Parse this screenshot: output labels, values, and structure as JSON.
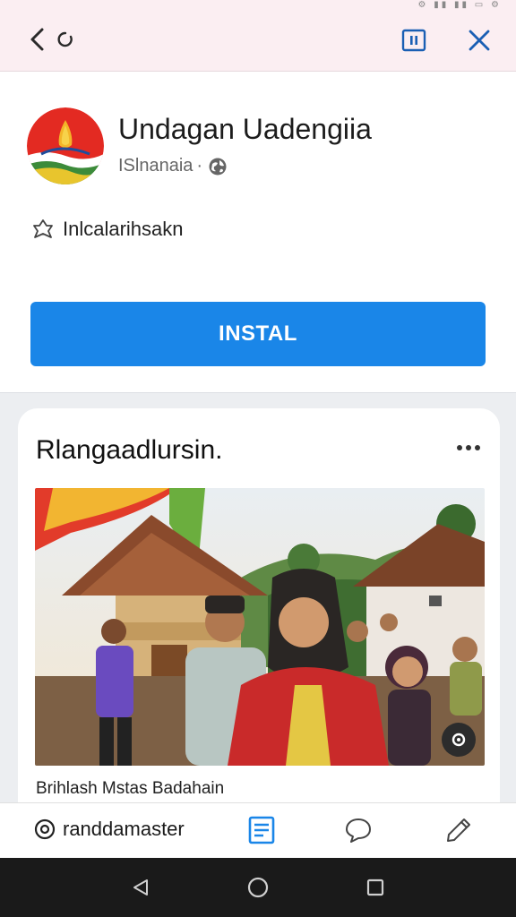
{
  "status_bar": {
    "icons": "⚙ ▮▮ ▮▮ ▭ ⚙"
  },
  "top_bar": {
    "back_icon": "chevron-left-icon",
    "reload_icon": "reload-icon",
    "menu_icon": "pause-box-icon",
    "close_icon": "close-icon"
  },
  "app": {
    "title": "Undagan Uadengiia",
    "publisher": "ISlnanaia",
    "separator": "·",
    "share_label": "Inlcalarihsakn",
    "install_label": "INSTAL",
    "accent_color": "#1a86e8"
  },
  "post": {
    "title": "Rlangaadlursin.",
    "caption": "Brihlash Mstas Badahain"
  },
  "bottom_bar": {
    "username": "randdamaster",
    "icons": [
      "at-icon",
      "document-icon",
      "comment-icon",
      "pen-icon"
    ]
  },
  "nav_bar": {
    "icons": [
      "back-triangle-icon",
      "home-circle-icon",
      "recents-square-icon"
    ]
  }
}
